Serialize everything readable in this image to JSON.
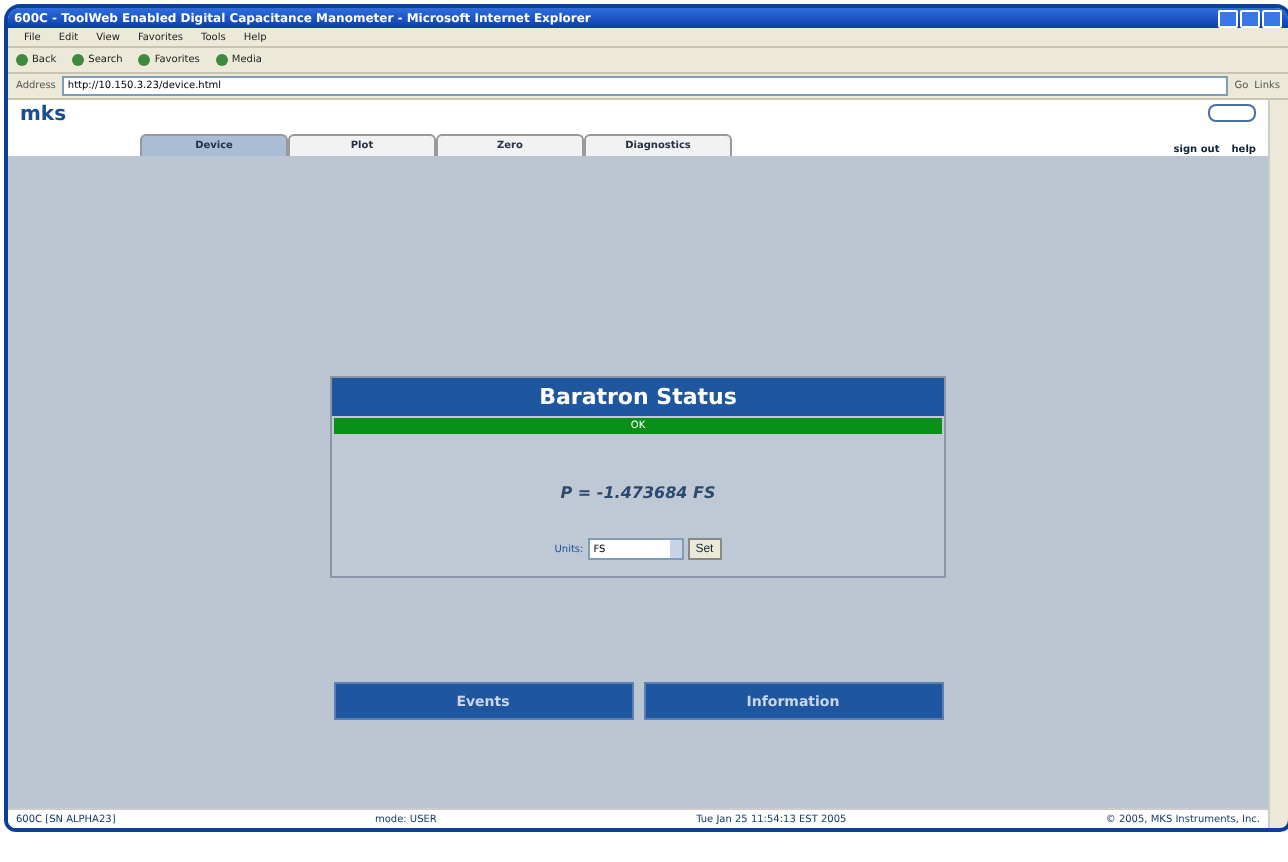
{
  "window": {
    "title": "600C - ToolWeb Enabled Digital Capacitance Manometer - Microsoft Internet Explorer"
  },
  "menu": [
    "File",
    "Edit",
    "View",
    "Favorites",
    "Tools",
    "Help"
  ],
  "toolbar": [
    "Back",
    "Search",
    "Favorites",
    "Media"
  ],
  "address": {
    "label": "Address",
    "value": "http://10.150.3.23/device.html",
    "go": "Go",
    "links": "Links"
  },
  "brand": "mks",
  "tabs": [
    {
      "label": "Device",
      "selected": true
    },
    {
      "label": "Plot",
      "selected": false
    },
    {
      "label": "Zero",
      "selected": false
    },
    {
      "label": "Diagnostics",
      "selected": false
    }
  ],
  "user_links": [
    "sign out",
    "help"
  ],
  "status_panel": {
    "title": "Baratron Status",
    "status": {
      "text": "OK",
      "color": "#089018"
    },
    "reading": "P = -1.473684 FS",
    "units_label": "Units:",
    "units_value": "FS",
    "set_button": "Set"
  },
  "nav_buttons": [
    "Events",
    "Information"
  ],
  "footer": [
    "600C [SN ALPHA23]",
    "mode: USER",
    "Tue Jan 25 11:54:13 EST 2005",
    "© 2005, MKS Instruments, Inc."
  ]
}
